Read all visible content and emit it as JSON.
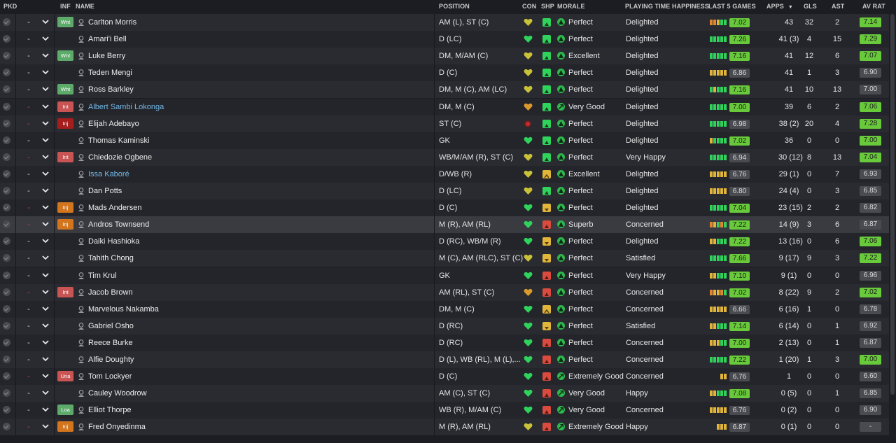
{
  "colors": {
    "good": "#68c93b",
    "bar_green": "#2fd35c",
    "bar_lightgreen": "#8fd96b",
    "bar_yellow": "#e0b53a",
    "bar_orange": "#e3872e",
    "bar_red": "#d94b3e",
    "name_blue": "#73b7e6"
  },
  "header": {
    "pkd": "PKD",
    "inf": "INF",
    "name": "NAME",
    "position": "POSITION",
    "con": "CON",
    "shp": "SHP",
    "morale": "MORALE",
    "playing_time": "PLAYING TIME HAPPINESS",
    "last5": "LAST 5 GAMES",
    "apps": "APPS",
    "gls": "GLS",
    "ast": "AST",
    "avrat": "AV RAT"
  },
  "rows": [
    {
      "dash": "-",
      "inf": "Wnt",
      "name": "Carlton Morris",
      "position": "AM (L), ST (C)",
      "con": "yellow-heart",
      "shp": "up",
      "morale": "Perfect",
      "pth": "Delighted",
      "l5": [
        "o",
        "o",
        "y",
        "g",
        "g"
      ],
      "l5rat": "7.02",
      "l5good": true,
      "apps": "43",
      "gls": "32",
      "ast": "2",
      "av": "7.14",
      "avgood": true
    },
    {
      "dash": "-",
      "inf": "",
      "name": "Amari'i Bell",
      "position": "D (LC)",
      "con": "green-heart",
      "shp": "up",
      "morale": "Perfect",
      "pth": "Delighted",
      "l5": [
        "g",
        "g",
        "g",
        "g",
        "g"
      ],
      "l5rat": "7.26",
      "l5good": true,
      "apps": "41 (3)",
      "gls": "4",
      "ast": "15",
      "av": "7.29",
      "avgood": true
    },
    {
      "dash": "-",
      "inf": "Wnt",
      "name": "Luke Berry",
      "position": "DM, M/AM (C)",
      "con": "yellow-heart",
      "shp": "up",
      "morale": "Excellent",
      "pth": "Delighted",
      "l5": [
        "g",
        "g",
        "g",
        "g",
        "g"
      ],
      "l5rat": "7.16",
      "l5good": true,
      "apps": "41",
      "gls": "12",
      "ast": "6",
      "av": "7.07",
      "avgood": true
    },
    {
      "dash": "-",
      "inf": "",
      "name": "Teden Mengi",
      "position": "D (C)",
      "con": "yellow-heart",
      "shp": "up",
      "morale": "Perfect",
      "pth": "Delighted",
      "l5": [
        "y",
        "y",
        "y",
        "y",
        "y"
      ],
      "l5rat": "6.86",
      "l5good": false,
      "apps": "41",
      "gls": "1",
      "ast": "3",
      "av": "6.90",
      "avgood": false
    },
    {
      "dash": "-",
      "inf": "Wnt",
      "name": "Ross Barkley",
      "position": "DM, M (C), AM (LC)",
      "con": "yellow-heart",
      "shp": "up",
      "morale": "Perfect",
      "pth": "Delighted",
      "l5": [
        "g",
        "y",
        "g",
        "g",
        "g"
      ],
      "l5rat": "7.16",
      "l5good": true,
      "apps": "41",
      "gls": "10",
      "ast": "13",
      "av": "7.00",
      "avgood": false
    },
    {
      "dash": "-",
      "inf": "Int",
      "name": "Albert Sambi Lokonga",
      "position": "DM, M (C)",
      "con": "orange-heart",
      "shp": "up",
      "morale": "Very Good",
      "pth": "Delighted",
      "l5": [
        "g",
        "g",
        "g",
        "g",
        "g"
      ],
      "l5rat": "7.00",
      "l5good": true,
      "apps": "39",
      "gls": "6",
      "ast": "2",
      "av": "7.06",
      "avgood": true,
      "blue": true
    },
    {
      "dash": "-",
      "inf": "Inj",
      "name": "Elijah Adebayo",
      "position": "ST (C)",
      "con": "red-dot",
      "shp": "up",
      "morale": "Perfect",
      "pth": "Delighted",
      "l5": [
        "g",
        "g",
        "g",
        "g",
        "g"
      ],
      "l5rat": "6.98",
      "l5good": false,
      "apps": "38 (2)",
      "gls": "20",
      "ast": "4",
      "av": "7.28",
      "avgood": true
    },
    {
      "dash": "-",
      "inf": "",
      "name": "Thomas Kaminski",
      "position": "GK",
      "con": "green-heart",
      "shp": "up",
      "morale": "Perfect",
      "pth": "Delighted",
      "l5": [
        "y",
        "g",
        "g",
        "g",
        "g"
      ],
      "l5rat": "7.02",
      "l5good": true,
      "apps": "36",
      "gls": "0",
      "ast": "0",
      "av": "7.00",
      "avgood": true
    },
    {
      "dash": "-",
      "inf": "Int",
      "name": "Chiedozie Ogbene",
      "position": "WB/M/AM (R), ST (C)",
      "con": "yellow-heart",
      "shp": "up",
      "morale": "Perfect",
      "pth": "Very Happy",
      "l5": [
        "g",
        "g",
        "g",
        "g",
        "g"
      ],
      "l5rat": "6.94",
      "l5good": false,
      "apps": "30 (12)",
      "gls": "8",
      "ast": "13",
      "av": "7.04",
      "avgood": true
    },
    {
      "dash": "-",
      "inf": "",
      "name": "Issa Kaboré",
      "position": "D/WB (R)",
      "con": "yellow-heart",
      "shp": "level",
      "morale": "Excellent",
      "pth": "Delighted",
      "l5": [
        "y",
        "y",
        "y",
        "y",
        "y"
      ],
      "l5rat": "6.76",
      "l5good": false,
      "apps": "29 (1)",
      "gls": "0",
      "ast": "7",
      "av": "6.93",
      "avgood": false,
      "blue": true
    },
    {
      "dash": "-",
      "inf": "",
      "name": "Dan Potts",
      "position": "D (LC)",
      "con": "yellow-heart",
      "shp": "up",
      "morale": "Perfect",
      "pth": "Delighted",
      "l5": [
        "y",
        "y",
        "y",
        "y",
        "y"
      ],
      "l5rat": "6.80",
      "l5good": false,
      "apps": "24 (4)",
      "gls": "0",
      "ast": "3",
      "av": "6.85",
      "avgood": false
    },
    {
      "dash": "-",
      "inf": "Inj",
      "name": "Mads Andersen",
      "position": "D (C)",
      "con": "green-heart",
      "shp": "down",
      "morale": "Perfect",
      "pth": "Delighted",
      "l5": [
        "g",
        "g",
        "g",
        "g",
        "g"
      ],
      "l5rat": "7.04",
      "l5good": true,
      "apps": "23 (15)",
      "gls": "2",
      "ast": "2",
      "av": "6.82",
      "avgood": false
    },
    {
      "dash": "-",
      "inf": "Inj",
      "name": "Andros Townsend",
      "position": "M (R), AM (RL)",
      "con": "green-heart",
      "shp": "red",
      "morale": "Superb",
      "pth": "Concerned",
      "l5": [
        "o",
        "y",
        "g",
        "o",
        "g"
      ],
      "l5rat": "7.22",
      "l5good": true,
      "apps": "14 (9)",
      "gls": "3",
      "ast": "6",
      "av": "6.87",
      "avgood": false,
      "sel": true
    },
    {
      "dash": "-",
      "inf": "",
      "name": "Daiki Hashioka",
      "position": "D (RC), WB/M (R)",
      "con": "green-heart",
      "shp": "down",
      "morale": "Perfect",
      "pth": "Delighted",
      "l5": [
        "y",
        "y",
        "g",
        "g",
        "g"
      ],
      "l5rat": "7.22",
      "l5good": true,
      "apps": "13 (16)",
      "gls": "0",
      "ast": "6",
      "av": "7.06",
      "avgood": true
    },
    {
      "dash": "-",
      "inf": "",
      "name": "Tahith Chong",
      "position": "M (C), AM (RLC), ST (C)",
      "con": "yellow-heart",
      "shp": "down",
      "morale": "Perfect",
      "pth": "Satisfied",
      "l5": [
        "g",
        "g",
        "g",
        "g",
        "g"
      ],
      "l5rat": "7.66",
      "l5good": true,
      "apps": "9 (17)",
      "gls": "9",
      "ast": "3",
      "av": "7.22",
      "avgood": true
    },
    {
      "dash": "-",
      "inf": "",
      "name": "Tim Krul",
      "position": "GK",
      "con": "green-heart",
      "shp": "red",
      "morale": "Perfect",
      "pth": "Very Happy",
      "l5": [
        "y",
        "y",
        "g",
        "g",
        "g"
      ],
      "l5rat": "7.10",
      "l5good": true,
      "apps": "9 (1)",
      "gls": "0",
      "ast": "0",
      "av": "6.96",
      "avgood": false
    },
    {
      "dash": "-",
      "inf": "Int",
      "name": "Jacob Brown",
      "position": "AM (RL), ST (C)",
      "con": "orange-heart",
      "shp": "red",
      "morale": "Perfect",
      "pth": "Concerned",
      "l5": [
        "o",
        "y",
        "y",
        "o",
        "g"
      ],
      "l5rat": "7.02",
      "l5good": true,
      "apps": "8 (22)",
      "gls": "9",
      "ast": "2",
      "av": "7.02",
      "avgood": true
    },
    {
      "dash": "-",
      "inf": "",
      "name": "Marvelous Nakamba",
      "position": "DM, M (C)",
      "con": "green-heart",
      "shp": "level",
      "morale": "Perfect",
      "pth": "Concerned",
      "l5": [
        "y",
        "y",
        "y",
        "y",
        "y"
      ],
      "l5rat": "6.66",
      "l5good": false,
      "apps": "6 (16)",
      "gls": "1",
      "ast": "0",
      "av": "6.78",
      "avgood": false
    },
    {
      "dash": "-",
      "inf": "",
      "name": "Gabriel Osho",
      "position": "D (RC)",
      "con": "green-heart",
      "shp": "down",
      "morale": "Perfect",
      "pth": "Satisfied",
      "l5": [
        "y",
        "y",
        "g",
        "g",
        "g"
      ],
      "l5rat": "7.14",
      "l5good": true,
      "apps": "6 (14)",
      "gls": "0",
      "ast": "1",
      "av": "6.92",
      "avgood": false
    },
    {
      "dash": "-",
      "inf": "",
      "name": "Reece Burke",
      "position": "D (RC)",
      "con": "green-heart",
      "shp": "red",
      "morale": "Perfect",
      "pth": "Concerned",
      "l5": [
        "y",
        "y",
        "y",
        "g",
        "g"
      ],
      "l5rat": "7.00",
      "l5good": true,
      "apps": "2 (13)",
      "gls": "0",
      "ast": "1",
      "av": "6.87",
      "avgood": false
    },
    {
      "dash": "-",
      "inf": "",
      "name": "Alfie Doughty",
      "position": "D (L), WB (RL), M (L),...",
      "con": "green-heart",
      "shp": "red",
      "morale": "Perfect",
      "pth": "Concerned",
      "l5": [
        "g",
        "g",
        "g",
        "g",
        "g"
      ],
      "l5rat": "7.22",
      "l5good": true,
      "apps": "1 (20)",
      "gls": "1",
      "ast": "3",
      "av": "7.00",
      "avgood": true
    },
    {
      "dash": "-",
      "inf": "Una",
      "name": "Tom Lockyer",
      "position": "D (C)",
      "con": "green-heart",
      "shp": "red",
      "morale": "Extremely Good",
      "pth": "Concerned",
      "l5": [
        "",
        "",
        "",
        "y",
        "y"
      ],
      "l5rat": "6.76",
      "l5good": false,
      "apps": "1",
      "gls": "0",
      "ast": "0",
      "av": "6.60",
      "avgood": false
    },
    {
      "dash": "-",
      "inf": "",
      "name": "Cauley Woodrow",
      "position": "AM (C), ST (C)",
      "con": "green-heart",
      "shp": "red",
      "morale": "Very Good",
      "pth": "Happy",
      "l5": [
        "y",
        "y",
        "g",
        "g",
        "g"
      ],
      "l5rat": "7.08",
      "l5good": true,
      "apps": "0 (5)",
      "gls": "0",
      "ast": "1",
      "av": "6.85",
      "avgood": false
    },
    {
      "dash": "-",
      "inf": "Loa",
      "name": "Elliot Thorpe",
      "position": "WB (R), M/AM (C)",
      "con": "green-heart",
      "shp": "red",
      "morale": "Very Good",
      "pth": "Concerned",
      "l5": [
        "y",
        "y",
        "y",
        "y",
        "y"
      ],
      "l5rat": "6.76",
      "l5good": false,
      "apps": "0 (2)",
      "gls": "0",
      "ast": "0",
      "av": "6.90",
      "avgood": false
    },
    {
      "dash": "-",
      "inf": "Inj",
      "name": "Fred Onyedinma",
      "position": "M (R), AM (RL)",
      "con": "yellow-heart",
      "shp": "red",
      "morale": "Extremely Good",
      "pth": "Happy",
      "l5": [
        "",
        "",
        "y",
        "y",
        "y"
      ],
      "l5rat": "6.87",
      "l5good": false,
      "apps": "0 (1)",
      "gls": "0",
      "ast": "0",
      "av": "-",
      "avgood": false
    }
  ]
}
